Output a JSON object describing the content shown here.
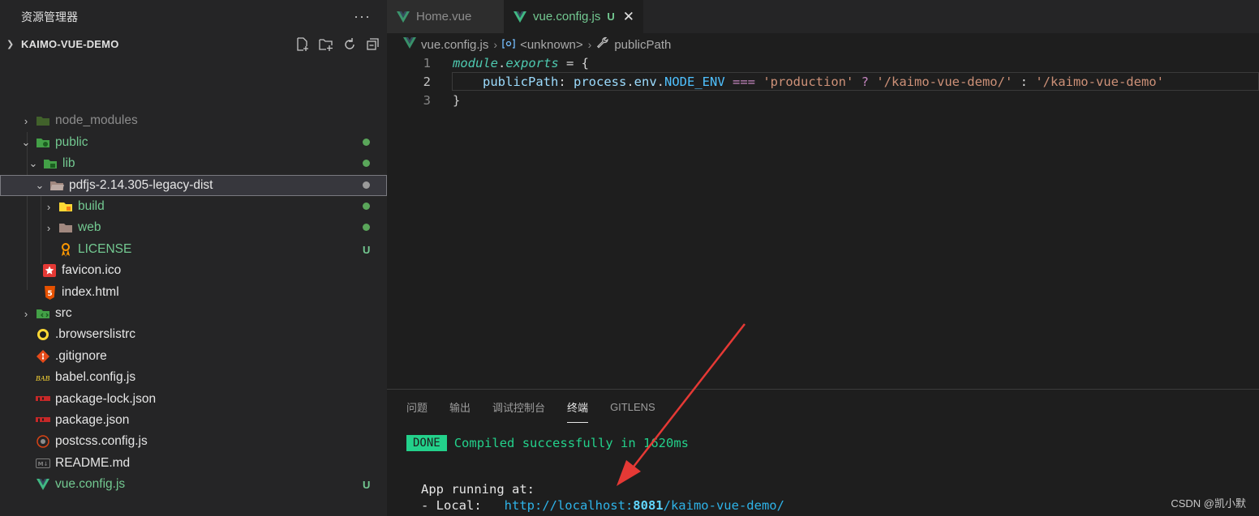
{
  "sidebar": {
    "title": "资源管理器",
    "more": "···",
    "project": "KAIMO-VUE-DEMO",
    "items": [
      {
        "label": "node_modules",
        "status": "",
        "icon": "node-modules-folder-icon"
      },
      {
        "label": "public",
        "status": "dot",
        "icon": "public-folder-icon"
      },
      {
        "label": "lib",
        "status": "dot",
        "icon": "lib-folder-icon"
      },
      {
        "label": "pdfjs-2.14.305-legacy-dist",
        "status": "dot-grey",
        "icon": "folder-open-icon"
      },
      {
        "label": "build",
        "status": "dot",
        "icon": "build-folder-icon"
      },
      {
        "label": "web",
        "status": "dot",
        "icon": "folder-icon"
      },
      {
        "label": "LICENSE",
        "status": "U",
        "icon": "license-icon"
      },
      {
        "label": "favicon.ico",
        "status": "",
        "icon": "star-icon"
      },
      {
        "label": "index.html",
        "status": "",
        "icon": "html5-icon"
      },
      {
        "label": "src",
        "status": "",
        "icon": "src-folder-icon"
      },
      {
        "label": ".browserslistrc",
        "status": "",
        "icon": "browserslist-icon"
      },
      {
        "label": ".gitignore",
        "status": "",
        "icon": "git-icon"
      },
      {
        "label": "babel.config.js",
        "status": "",
        "icon": "babel-icon"
      },
      {
        "label": "package-lock.json",
        "status": "",
        "icon": "npm-icon"
      },
      {
        "label": "package.json",
        "status": "",
        "icon": "npm-icon"
      },
      {
        "label": "postcss.config.js",
        "status": "",
        "icon": "postcss-icon"
      },
      {
        "label": "README.md",
        "status": "",
        "icon": "markdown-icon"
      },
      {
        "label": "vue.config.js",
        "status": "U",
        "icon": "vue-icon"
      }
    ]
  },
  "tabs": [
    {
      "label": "Home.vue"
    },
    {
      "label": "vue.config.js",
      "status": "U",
      "close": "✕"
    }
  ],
  "breadcrumb": [
    "vue.config.js",
    "<unknown>",
    "publicPath"
  ],
  "code": {
    "line_numbers": [
      "1",
      "2",
      "3"
    ],
    "l1": {
      "a": "module",
      "b": ".",
      "c": "exports",
      "d": " = {"
    },
    "l2": {
      "prop": "publicPath",
      "colon": ": ",
      "p1": "process",
      "d1": ".",
      "p2": "env",
      "d2": ".",
      "p3": "NODE_ENV",
      "eq": " === ",
      "s1": "'production'",
      "q": " ? ",
      "s2": "'/kaimo-vue-demo/'",
      "c2": " : ",
      "s3": "'/kaimo-vue-demo'"
    },
    "l3": "}"
  },
  "panel": {
    "tabs": [
      "问题",
      "输出",
      "调试控制台",
      "终端",
      "GITLENS"
    ],
    "active_tab": "终端",
    "done": "DONE",
    "done_msg": "Compiled successfully in 1620ms",
    "running": "App running at:",
    "local_prefix": "- Local:   ",
    "url_a": "http://localhost:",
    "url_port": "8081",
    "url_b": "/kaimo-vue-demo/"
  },
  "watermark": "CSDN @凯小默",
  "colors": {
    "accent_green": "#73c991",
    "terminal_green": "#23d18b",
    "link": "#2eb3e8",
    "arrow": "#e53935"
  }
}
